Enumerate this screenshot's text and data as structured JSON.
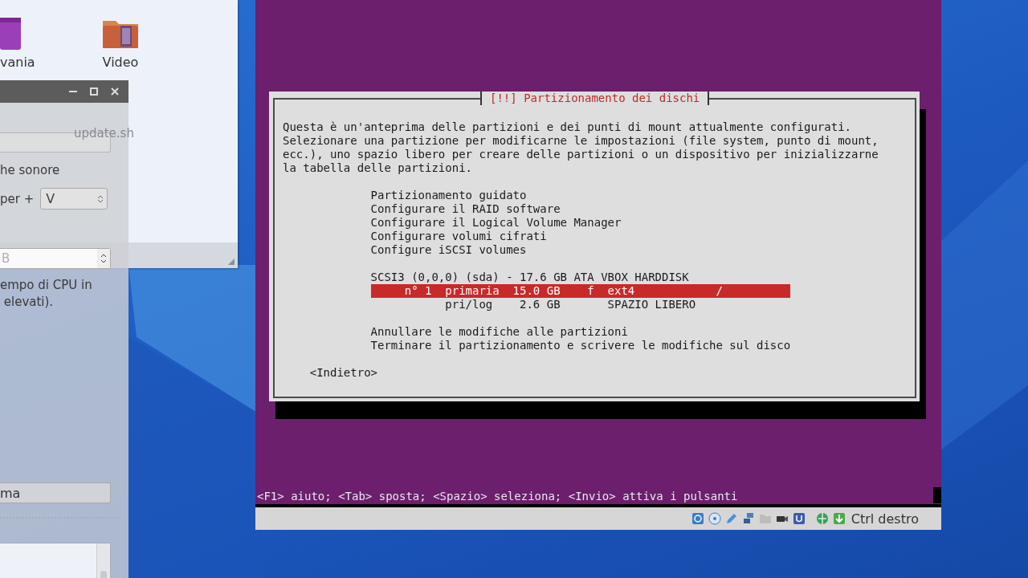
{
  "file_manager": {
    "items": [
      {
        "kind": "app",
        "label": "vania"
      },
      {
        "kind": "video-folder",
        "label": "Video"
      }
    ],
    "faded_labels": [
      "update.sh"
    ]
  },
  "settings_window": {
    "items": [
      {
        "kind": "field"
      },
      {
        "kind": "label",
        "text": "he sonore"
      },
      {
        "kind": "combo",
        "label": "per +",
        "value": "V"
      },
      {
        "kind": "spin",
        "placeholder": "B"
      },
      {
        "kind": "text",
        "text": "empo di CPU in\n elevati)."
      },
      {
        "kind": "button",
        "label": "ma"
      },
      {
        "kind": "separator"
      },
      {
        "kind": "list"
      }
    ]
  },
  "vm": {
    "dialog": {
      "title": "[!!] Partizionamento dei dischi",
      "description": "Questa è un'anteprima delle partizioni e dei punti di mount attualmente configurati.\nSelezionare una partizione per modificarne le impostazioni (file system, punto di mount,\necc.), uno spazio libero per creare delle partizioni o un dispositivo per inizializzarne\nla tabella delle partizioni.",
      "menu": [
        "Partizionamento guidato",
        "Configurare il RAID software",
        "Configurare il Logical Volume Manager",
        "Configurare volumi cifrati",
        "Configure iSCSI volumes"
      ],
      "device": "SCSI3 (0,0,0) (sda) - 17.6 GB ATA VBOX HARDDISK",
      "partitions": [
        {
          "text": "     n° 1  primaria  15.0 GB    f  ext4            /",
          "selected": true
        },
        {
          "text": "           pri/log    2.6 GB       SPAZIO LIBERO",
          "selected": false
        }
      ],
      "actions": [
        "Annullare le modifiche alle partizioni",
        "Terminare il partizionamento e scrivere le modifiche sul disco"
      ],
      "back_button": "<Indietro>"
    },
    "help_line": "<F1> aiuto; <Tab> sposta; <Spazio> seleziona; <Invio> attiva i pulsanti",
    "status_bar": {
      "host_key": "Ctrl destro"
    }
  }
}
